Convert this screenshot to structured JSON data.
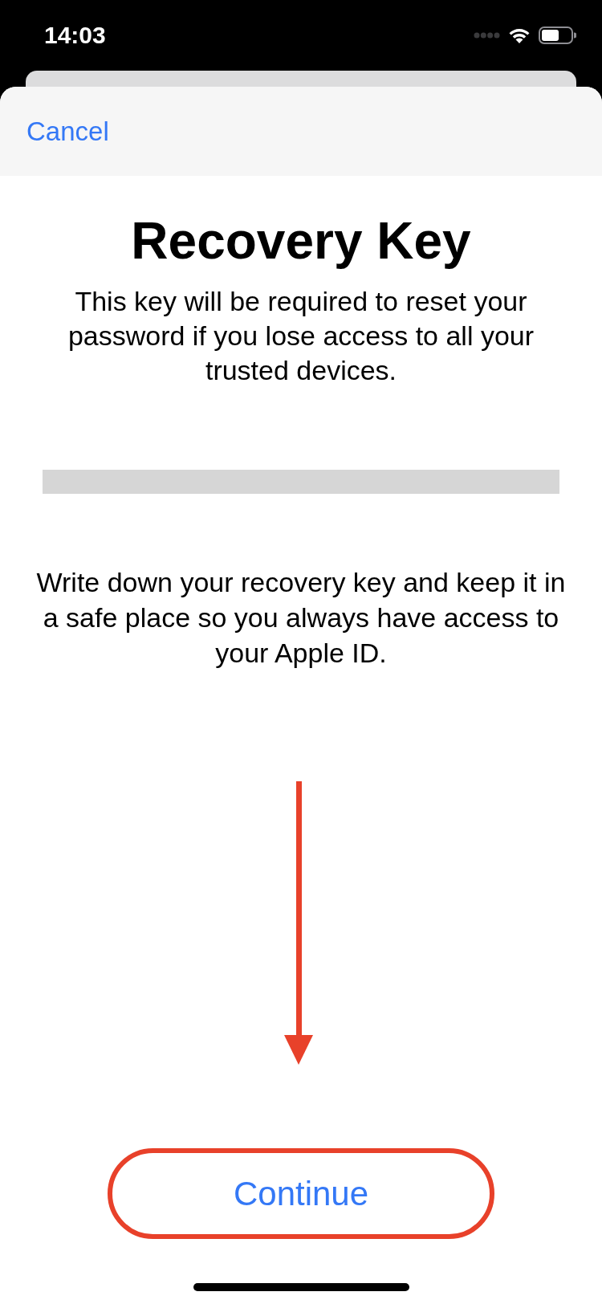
{
  "status_bar": {
    "time": "14:03"
  },
  "sheet": {
    "cancel": "Cancel"
  },
  "title": "Recovery Key",
  "description": "This key will be required to reset your password if you lose access to all your trusted devices.",
  "instruction": "Write down your recovery key and keep it in a safe place so you always have access to your Apple ID.",
  "continue_button": {
    "label": "Continue",
    "highlighted": true
  }
}
